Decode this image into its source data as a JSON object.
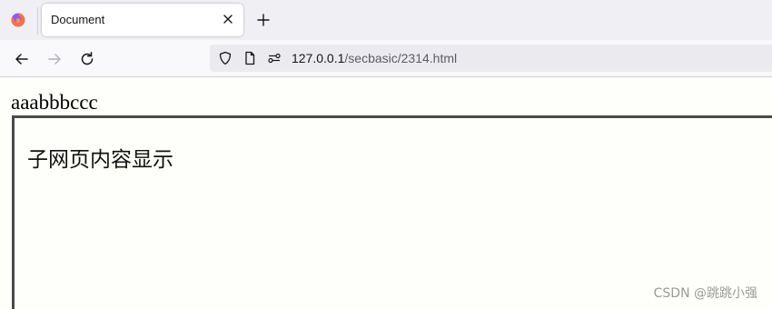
{
  "tab": {
    "title": "Document",
    "close_icon": "close-icon",
    "new_tab_icon": "plus-icon"
  },
  "nav": {
    "back_icon": "arrow-left-icon",
    "forward_icon": "arrow-right-icon",
    "reload_icon": "reload-icon"
  },
  "urlbar": {
    "host": "127.0.0.1",
    "path": "/secbasic/2314.html"
  },
  "page": {
    "text": "aaabbbccc",
    "iframe_text": "子网页内容显示"
  },
  "watermark": "CSDN @跳跳小强",
  "colors": {
    "firefox_orange": "#ff7139",
    "firefox_purple": "#9059ff"
  }
}
